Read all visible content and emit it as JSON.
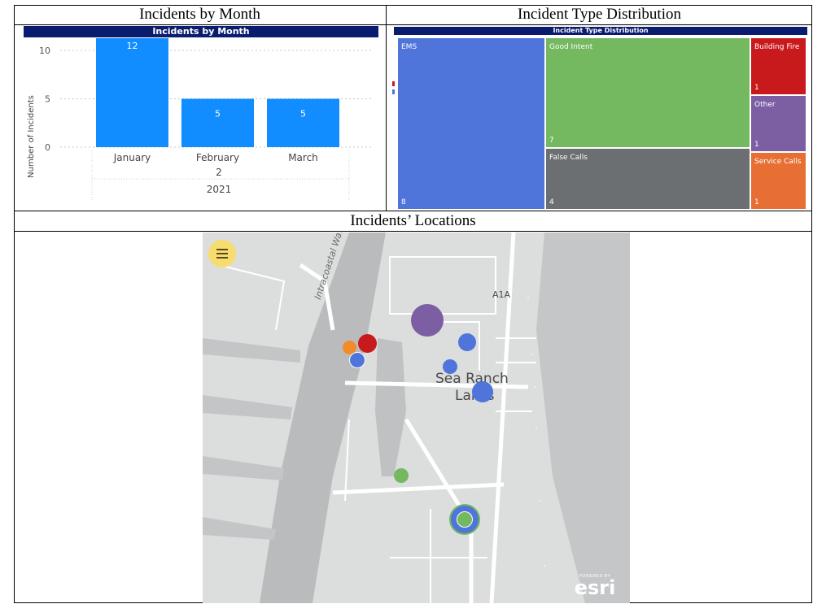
{
  "cells": {
    "month_title": "Incidents by Month",
    "type_title": "Incident Type Distribution",
    "location_title": "Incidents’ Locations"
  },
  "month_chart": {
    "header": "Incidents by Month",
    "ylabel": "Number of Incidents",
    "yticks": [
      "10",
      "5",
      "0"
    ],
    "quarter_label": "2",
    "year_label": "2021",
    "bar_color": "#118dff"
  },
  "treemap": {
    "header": "Incident Type Distribution",
    "tiles": [
      {
        "label": "EMS",
        "value": "8",
        "color": "#4f75db"
      },
      {
        "label": "Good Intent",
        "value": "7",
        "color": "#74b860"
      },
      {
        "label": "False Calls",
        "value": "4",
        "color": "#6c6f72"
      },
      {
        "label": "Building Fire",
        "value": "1",
        "color": "#c8191d"
      },
      {
        "label": "Other",
        "value": "1",
        "color": "#7c5ea3"
      },
      {
        "label": "Service Calls",
        "value": "1",
        "color": "#e76f34"
      }
    ]
  },
  "map": {
    "road_label": "A1A",
    "waterway_label": "Intracoastal Waterway",
    "place_label_line1": "Sea Ranch",
    "place_label_line2": "Lakes",
    "attribution_small": "POWERED BY",
    "attribution_brand": "esri"
  },
  "chart_data": {
    "type": "bar",
    "categories": [
      "January",
      "February",
      "March"
    ],
    "values": [
      12,
      5,
      5
    ],
    "title": "Incidents by Month",
    "xlabel": "",
    "ylabel": "Number of Incidents",
    "ylim": [
      0,
      11
    ],
    "grid": true
  }
}
